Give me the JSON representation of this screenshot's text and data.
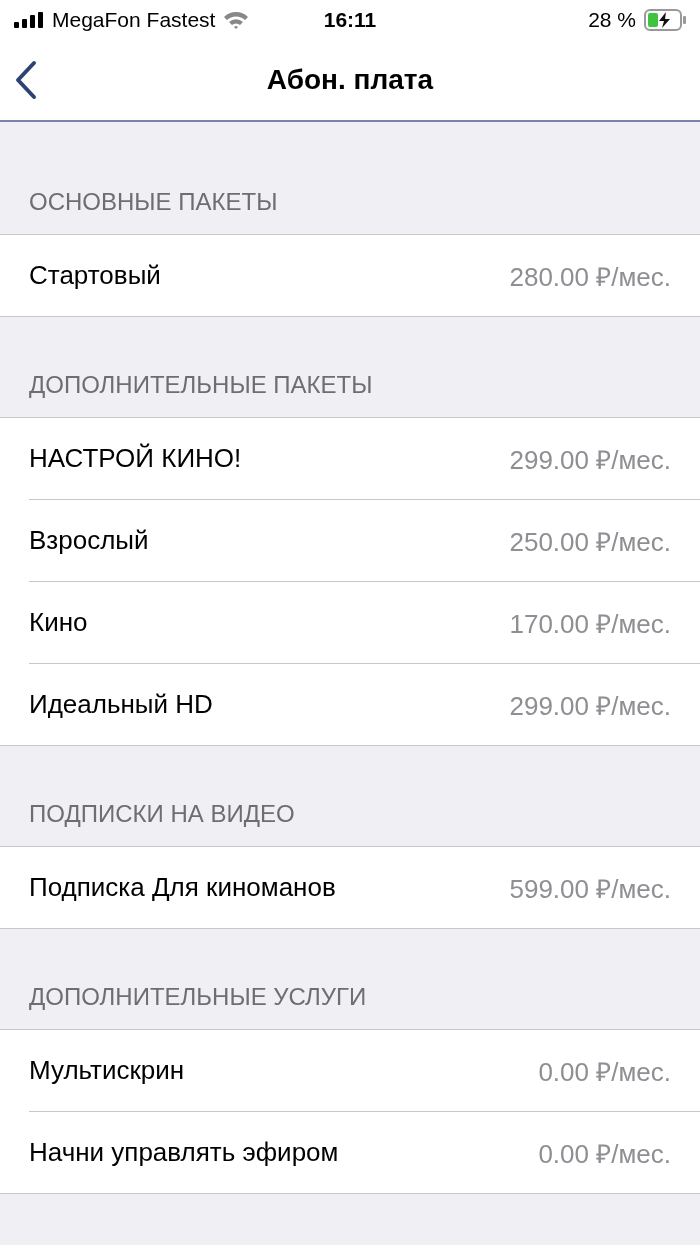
{
  "status_bar": {
    "carrier": "MegaFon Fastest",
    "time": "16:11",
    "battery": "28 %"
  },
  "nav": {
    "title": "Абон. плата"
  },
  "sections": [
    {
      "title": "ОСНОВНЫЕ ПАКЕТЫ",
      "items": [
        {
          "name": "Стартовый",
          "price": "280.00 ₽/мес."
        }
      ]
    },
    {
      "title": "ДОПОЛНИТЕЛЬНЫЕ ПАКЕТЫ",
      "items": [
        {
          "name": "НАСТРОЙ КИНО!",
          "price": "299.00 ₽/мес."
        },
        {
          "name": "Взрослый",
          "price": "250.00 ₽/мес."
        },
        {
          "name": "Кино",
          "price": "170.00 ₽/мес."
        },
        {
          "name": "Идеальный HD",
          "price": "299.00 ₽/мес."
        }
      ]
    },
    {
      "title": "ПОДПИСКИ НА ВИДЕО",
      "items": [
        {
          "name": "Подписка Для киноманов",
          "price": "599.00 ₽/мес."
        }
      ]
    },
    {
      "title": "ДОПОЛНИТЕЛЬНЫЕ УСЛУГИ",
      "items": [
        {
          "name": "Мультискрин",
          "price": "0.00 ₽/мес."
        },
        {
          "name": "Начни управлять эфиром",
          "price": "0.00 ₽/мес."
        }
      ]
    }
  ]
}
